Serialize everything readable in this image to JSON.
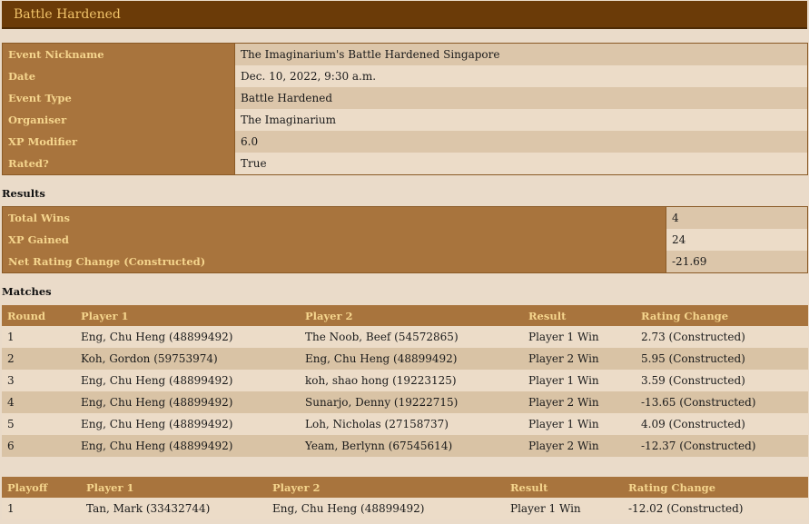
{
  "title": "Battle Hardened",
  "event": [
    {
      "label": "Event Nickname",
      "value": "The Imaginarium's Battle Hardened Singapore"
    },
    {
      "label": "Date",
      "value": "Dec. 10, 2022, 9:30 a.m."
    },
    {
      "label": "Event Type",
      "value": "Battle Hardened"
    },
    {
      "label": "Organiser",
      "value": "The Imaginarium"
    },
    {
      "label": "XP Modifier",
      "value": "6.0"
    },
    {
      "label": "Rated?",
      "value": "True"
    }
  ],
  "results": {
    "heading": "Results",
    "rows": [
      {
        "label": "Total Wins",
        "value": "4"
      },
      {
        "label": "XP Gained",
        "value": "24"
      },
      {
        "label": "Net Rating Change (Constructed)",
        "value": "-21.69"
      }
    ]
  },
  "matches": {
    "heading": "Matches",
    "columns": [
      "Round",
      "Player 1",
      "Player 2",
      "Result",
      "Rating Change"
    ],
    "rows": [
      [
        "1",
        "Eng, Chu Heng (48899492)",
        "The Noob, Beef (54572865)",
        "Player 1 Win",
        "2.73 (Constructed)"
      ],
      [
        "2",
        "Koh, Gordon (59753974)",
        "Eng, Chu Heng (48899492)",
        "Player 2 Win",
        "5.95 (Constructed)"
      ],
      [
        "3",
        "Eng, Chu Heng (48899492)",
        "koh, shao hong (19223125)",
        "Player 1 Win",
        "3.59 (Constructed)"
      ],
      [
        "4",
        "Eng, Chu Heng (48899492)",
        "Sunarjo, Denny (19222715)",
        "Player 2 Win",
        "-13.65 (Constructed)"
      ],
      [
        "5",
        "Eng, Chu Heng (48899492)",
        "Loh, Nicholas (27158737)",
        "Player 1 Win",
        "4.09 (Constructed)"
      ],
      [
        "6",
        "Eng, Chu Heng (48899492)",
        "Yeam, Berlynn (67545614)",
        "Player 2 Win",
        "-12.37 (Constructed)"
      ]
    ]
  },
  "playoffs": {
    "columns": [
      "Playoff",
      "Player 1",
      "Player 2",
      "Result",
      "Rating Change"
    ],
    "rows": [
      [
        "1",
        "Tan, Mark (33432744)",
        "Eng, Chu Heng (48899492)",
        "Player 1 Win",
        "-12.02 (Constructed)"
      ]
    ]
  },
  "colors": {
    "title_bg": "#6b3b08",
    "title_text": "#f2c46a",
    "label_bg": "#a8743d",
    "label_text": "#f5d58d"
  }
}
